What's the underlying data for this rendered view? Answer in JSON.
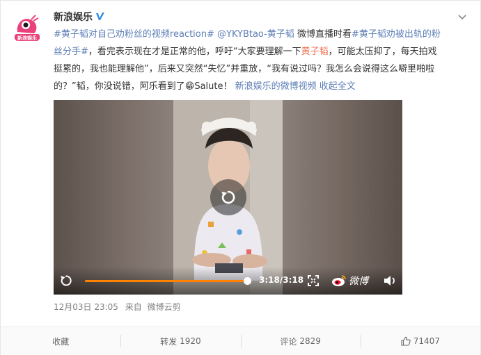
{
  "post": {
    "username": "新浪娱乐",
    "content_line1_parts": [
      {
        "text": "#黄子韬对自己劝粉丝的视频reaction#",
        "style": "lk"
      },
      {
        "text": " ",
        "style": ""
      },
      {
        "text": "@YKYBtao-黄子韬",
        "style": "lk"
      },
      {
        "text": " 微博直播时看",
        "style": ""
      },
      {
        "text": "#黄子韬劝被出轨的粉",
        "style": "lk"
      }
    ],
    "content_line2_parts": [
      {
        "text": "丝分手#",
        "style": "lk"
      },
      {
        "text": "，看完表示现在才是正常的他，呼吁“大家要理解一下",
        "style": ""
      },
      {
        "text": "黄子韬",
        "style": "hl"
      },
      {
        "text": "，可能太压抑了，每天拍戏",
        "style": ""
      }
    ],
    "content_line3": "挺累的，我也能理解他”，后来又突然“失忆”并重放，“我有说过吗？我怎么会说得这么噼里啪啦",
    "content_line4_parts": [
      {
        "text": "的？”韬，你没说错，阿乐看到了",
        "style": ""
      },
      {
        "text": "😁",
        "style": "emoji"
      },
      {
        "text": "Salute！",
        "style": ""
      },
      {
        "text": " ",
        "style": ""
      },
      {
        "text": "新浪娱乐的微博视频",
        "style": "lk"
      },
      {
        "text": " 收起全文",
        "style": "lk"
      }
    ],
    "meta": {
      "time": "12月03日 23:05",
      "source_prefix": "来自",
      "source": "微博云剪"
    }
  },
  "video": {
    "current_time": "3:18",
    "duration": "3:18",
    "time_display": "3:18/3:18",
    "progress_fraction": 1.0,
    "weibo_label": "微博"
  },
  "actions": {
    "favorite": "收藏",
    "repost_label": "转发",
    "repost_count": "1920",
    "comment_label": "评论",
    "comment_count": "2829",
    "like_count": "71407"
  },
  "colors": {
    "link": "#5d7eb6",
    "highlight": "#eb7350",
    "progress": "#ff8200",
    "verified": "#f7b500"
  }
}
